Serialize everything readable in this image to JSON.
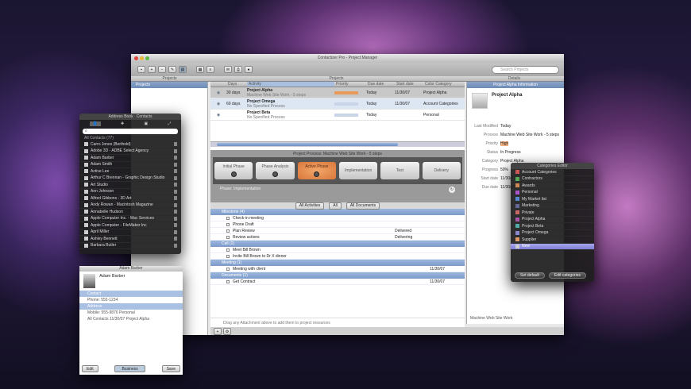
{
  "main": {
    "title": "Contactizer Pro - Project Manager",
    "search_placeholder": "Search Projects",
    "col_headers": [
      "Projects",
      "Projects",
      "Details"
    ],
    "sidebar_header": "Projects",
    "table_headers": [
      "",
      "Days",
      "Activity",
      "Priority",
      "Due date",
      "Start date",
      "Color Category"
    ],
    "projects": [
      {
        "days": "30 days",
        "name": "Project Alpha",
        "sub": "Machine Web Site Work - 5 steps",
        "due": "Today",
        "start": "11/30/07",
        "category": "Project Alpha",
        "selected": true
      },
      {
        "days": "60 days",
        "name": "Project Omega",
        "sub": "No Specified Process",
        "due": "Today",
        "start": "11/30/07",
        "category": "Account Categories",
        "selected": false
      },
      {
        "days": "",
        "name": "Project Beta",
        "sub": "No Specified Process",
        "due": "Today",
        "start": "",
        "category": "Personal",
        "selected": false
      }
    ],
    "process_title": "Project Process: Machine Web Site Work - 5 steps",
    "steps": [
      "Initial Phase",
      "Phase Analysis",
      "Active Phase",
      "Implementation",
      "Test",
      "Delivery"
    ],
    "active_step": 2,
    "process_footer": "Phase: Implementation",
    "filter_bar": [
      "All Activities",
      "All",
      "All Documents"
    ],
    "groups": [
      {
        "name": "Milestone (4)",
        "items": [
          {
            "t": "Check-in meeting",
            "s": "",
            "d": ""
          },
          {
            "t": "Phone Draft",
            "s": "",
            "d": ""
          },
          {
            "t": "Plan Review",
            "s": "Delivered",
            "d": ""
          },
          {
            "t": "Review actions",
            "s": "Delivering",
            "d": ""
          }
        ]
      },
      {
        "name": "Call (2)",
        "items": [
          {
            "t": "Meet Bill Brown",
            "s": "",
            "d": ""
          },
          {
            "t": "Invite Bill Brown to Dr X dinner",
            "s": "",
            "d": ""
          }
        ]
      },
      {
        "name": "Meeting (1)",
        "items": [
          {
            "t": "Meeting with client",
            "s": "",
            "d": "11/30/07"
          }
        ]
      },
      {
        "name": "Documents (1)",
        "items": [
          {
            "t": "Get Contract",
            "s": "",
            "d": "11/30/07"
          }
        ]
      }
    ],
    "drop_hint": "Drag any Attachment above to add them to project resources",
    "details": {
      "header": "Project Alpha Information",
      "name": "Project Alpha",
      "fields": [
        [
          "Last Modified",
          "Today"
        ],
        [
          "Process",
          "Machine Web Site Work - 5 steps"
        ],
        [
          "Priority",
          "High"
        ],
        [
          "Status",
          "In Progress"
        ],
        [
          "Category",
          "Project Alpha"
        ],
        [
          "Progress",
          "50%"
        ],
        [
          "Start date",
          "11/30/07"
        ],
        [
          "Due date",
          "11/30/07"
        ]
      ],
      "footer": "Machine Web Site Work"
    }
  },
  "addressbook": {
    "title": "Address Book",
    "tab2": "Contacts",
    "group": "All Contacts (77)",
    "items": [
      "Carro Jones (Berthold)",
      "Adobe 3D - ADBE Select Agency",
      "Adam Barber",
      "Adam Smith",
      "Active Lee",
      "Arthur C Brennan - Graphic Design Studio",
      "Art Studio",
      "Ann Johnson",
      "Alfred Gibbons - 3D Art",
      "Andy Rowan - Macintosh Magazine",
      "Annabelle Hudson",
      "Apple Computer Inc. - Mac Services",
      "Apple Computer - FileMaker Inc",
      "April Miller",
      "Ashley Bennett",
      "Barbara Butler"
    ]
  },
  "categories": {
    "title": "Categories Editor",
    "items": [
      "Account Categories",
      "Contractors",
      "Awards",
      "Personal",
      "My Market list",
      "Marketing",
      "Private",
      "Project Alpha",
      "Project Beta",
      "Project Omega",
      "Supplier",
      "New"
    ],
    "selected": 11,
    "buttons": [
      "Set default",
      "Edit categories"
    ]
  },
  "contact": {
    "title": "Adam Barber",
    "name": "Adam Barber",
    "rows": [
      "Contact",
      "Phone: 555-1234",
      "Address",
      "Mobile: 555-9876 Personal",
      "All Contacts  11/30/07  Project Alpha"
    ],
    "buttons": [
      "Edit",
      "Business",
      "Save"
    ]
  }
}
